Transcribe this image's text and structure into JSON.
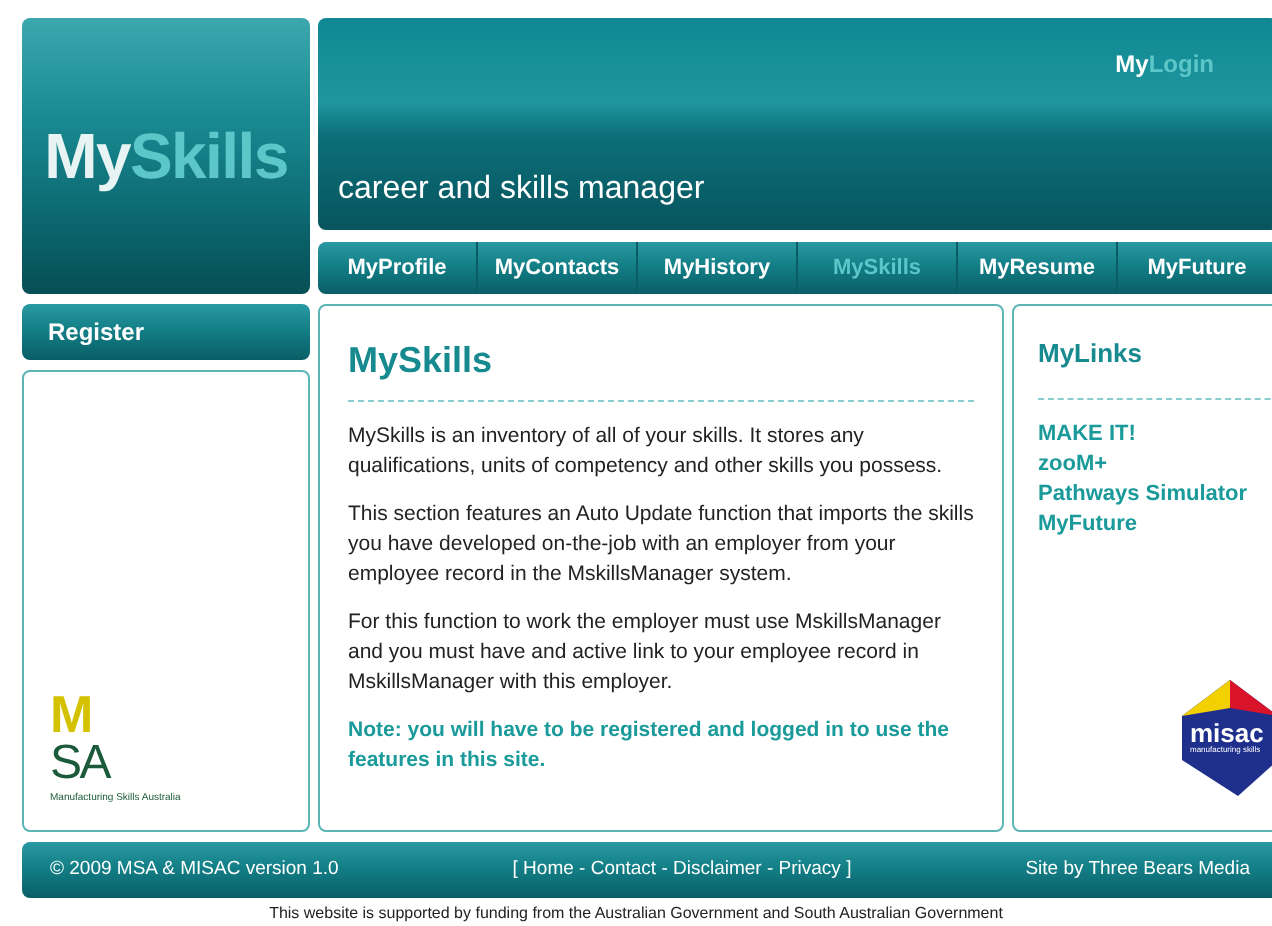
{
  "logo": {
    "my": "My",
    "skills": "Skills"
  },
  "header": {
    "login_prefix": "My",
    "login_suffix": "Login",
    "tagline": "career and skills manager"
  },
  "nav": [
    {
      "label": "MyProfile",
      "selected": false
    },
    {
      "label": "MyContacts",
      "selected": false
    },
    {
      "label": "MyHistory",
      "selected": false
    },
    {
      "label": "MySkills",
      "selected": true
    },
    {
      "label": "MyResume",
      "selected": false
    },
    {
      "label": "MyFuture",
      "selected": false
    }
  ],
  "sidebar": {
    "button": "Register",
    "msa_logo": {
      "top": "M",
      "bottom": "SA",
      "caption": "Manufacturing Skills Australia"
    }
  },
  "main": {
    "title": "MySkills",
    "paragraphs": [
      "MySkills is an inventory of all of your skills. It stores any qualifications, units of competency and other skills you possess.",
      "This section features an Auto Update function that imports the skills you have developed on-the-job with an employer from your employee record in the MskillsManager system.",
      "For this function to work the employer must use MskillsManager and you must have and active link to your employee record in MskillsManager with this employer."
    ],
    "note": "Note: you will have to be registered and logged in to use the features in this site."
  },
  "links": {
    "title": "MyLinks",
    "items": [
      "MAKE IT!",
      "zooM+",
      "Pathways Simulator",
      "MyFuture"
    ],
    "misac_logo": {
      "name": "misac",
      "caption": "manufacturing skills"
    }
  },
  "footer": {
    "copyright": "© 2009 MSA & MISAC version 1.0",
    "links": "[ Home - Contact - Disclaimer - Privacy ]",
    "credit": "Site by Three Bears Media"
  },
  "funding": "This website is supported by funding from the Australian Government and South Australian Government"
}
